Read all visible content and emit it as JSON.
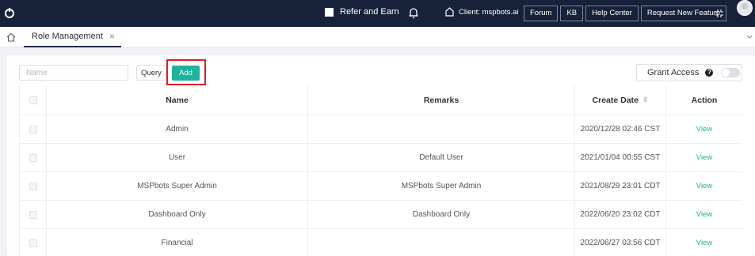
{
  "header": {
    "refer_label": "Refer and Earn",
    "client_label": "Client: mspbots.ai",
    "nav_buttons": [
      "Forum",
      "KB",
      "Help Center",
      "Request New Feature"
    ]
  },
  "tabs": {
    "active_tab": "Role Management",
    "close_glyph": "×"
  },
  "toolbar": {
    "name_placeholder": "Name",
    "query_label": "Query",
    "add_label": "Add",
    "grant_access_label": "Grant Access",
    "help_glyph": "?"
  },
  "table": {
    "headers": {
      "name": "Name",
      "remarks": "Remarks",
      "create_date": "Create Date",
      "action": "Action"
    },
    "rows": [
      {
        "name": "Admin",
        "remarks": "",
        "create_date": "2020/12/28 02:46 CST",
        "action": "View"
      },
      {
        "name": "User",
        "remarks": "Default User",
        "create_date": "2021/01/04 00:55 CST",
        "action": "View"
      },
      {
        "name": "MSPbots Super Admin",
        "remarks": "MSPbots Super Admin",
        "create_date": "2021/08/29 23:01 CDT",
        "action": "View"
      },
      {
        "name": "Dashboard Only",
        "remarks": "Dashboard Only",
        "create_date": "2022/06/20 23:02 CDT",
        "action": "View"
      },
      {
        "name": "Financial",
        "remarks": "",
        "create_date": "2022/06/27 03:56 CDT",
        "action": "View"
      }
    ]
  },
  "colors": {
    "topbar_bg": "#17223a",
    "add_button": "#20b29a",
    "highlight_box": "#e31b23",
    "view_link": "#1fb29a"
  }
}
